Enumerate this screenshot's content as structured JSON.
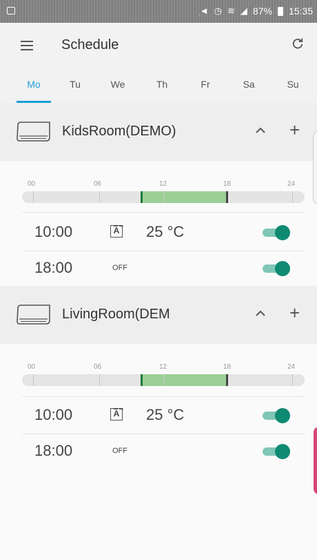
{
  "status_bar": {
    "battery": "87%",
    "time": "15:35"
  },
  "app_bar": {
    "title": "Schedule"
  },
  "tabs": [
    {
      "label": "Mo",
      "active": true
    },
    {
      "label": "Tu"
    },
    {
      "label": "We"
    },
    {
      "label": "Th"
    },
    {
      "label": "Fr"
    },
    {
      "label": "Sa"
    },
    {
      "label": "Su"
    }
  ],
  "timeline_labels": [
    "00",
    "06",
    "12",
    "18",
    "24"
  ],
  "rooms": [
    {
      "name": "KidsRoom(DEMO)",
      "schedule_on_hours": [
        10,
        18
      ],
      "entries": [
        {
          "time": "10:00",
          "mode": "A",
          "temp": "25 °C",
          "enabled": true
        },
        {
          "time": "18:00",
          "off": "OFF",
          "enabled": true
        }
      ]
    },
    {
      "name": "LivingRoom(DEM",
      "schedule_on_hours": [
        10,
        18
      ],
      "entries": [
        {
          "time": "10:00",
          "mode": "A",
          "temp": "25 °C",
          "enabled": true
        },
        {
          "time": "18:00",
          "off": "OFF",
          "enabled": true
        }
      ]
    }
  ],
  "colors": {
    "accent": "#1a9fd8",
    "timeline_fill": "#9ccf96",
    "toggle_on": "#0f8a72",
    "toggle_track": "#7fc6b6"
  }
}
